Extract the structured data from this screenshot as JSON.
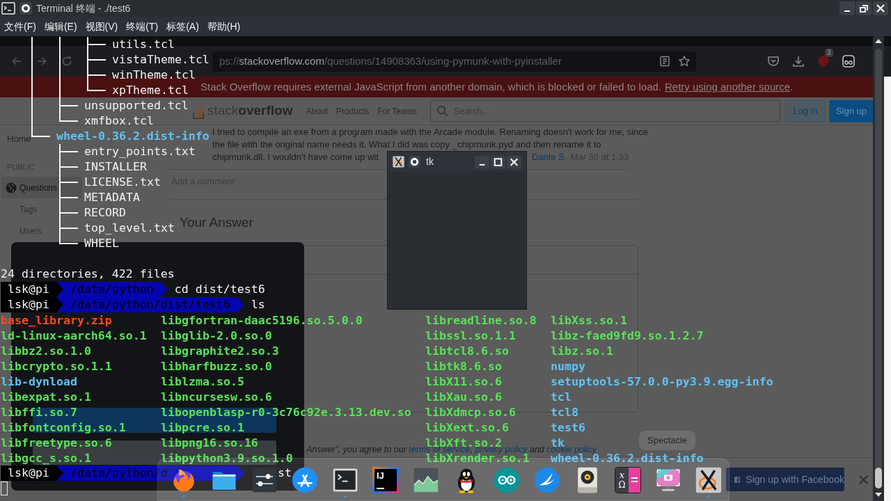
{
  "window": {
    "title": "Terminal 终端 - ./test6"
  },
  "menu": [
    "文件(F)",
    "编辑(E)",
    "视图(V)",
    "终端(T)",
    "标签(A)",
    "帮助(H)"
  ],
  "terminal": {
    "tree": [
      {
        "children": [
          {
            "children": [
              {
                "children": [
                  {
                    "name": "utils.tcl",
                    "kind": "file"
                  },
                  {
                    "name": "vistaTheme.tcl",
                    "kind": "file"
                  },
                  {
                    "name": "winTheme.tcl",
                    "kind": "file"
                  },
                  {
                    "name": "xpTheme.tcl",
                    "kind": "file"
                  }
                ]
              },
              {
                "name": "unsupported.tcl",
                "kind": "file"
              },
              {
                "name": "xmfbox.tcl",
                "kind": "file"
              }
            ]
          },
          {
            "name": "wheel-0.36.2.dist-info",
            "kind": "dir",
            "children": [
              {
                "name": "entry_points.txt",
                "kind": "file"
              },
              {
                "name": "INSTALLER",
                "kind": "file"
              },
              {
                "name": "LICENSE.txt",
                "kind": "file"
              },
              {
                "name": "METADATA",
                "kind": "file"
              },
              {
                "name": "RECORD",
                "kind": "file"
              },
              {
                "name": "top_level.txt",
                "kind": "file"
              },
              {
                "name": "WHEEL",
                "kind": "file"
              }
            ]
          }
        ]
      }
    ],
    "summary": "24 directories, 422 files",
    "prompts": [
      {
        "user": "lsk@pi",
        "path": "/data/python",
        "command": "cd dist/test6"
      },
      {
        "user": "lsk@pi",
        "path": "/data/python/dist/test6",
        "command": "ls"
      }
    ],
    "listing": [
      [
        {
          "name": "base_library.zip",
          "kind": "archive"
        },
        {
          "name": "ld-linux-aarch64.so.1",
          "kind": "exec"
        },
        {
          "name": "libbz2.so.1.0",
          "kind": "exec"
        },
        {
          "name": "libcrypto.so.1.1",
          "kind": "exec"
        },
        {
          "name": "lib-dynload",
          "kind": "dir"
        },
        {
          "name": "libexpat.so.1",
          "kind": "exec"
        },
        {
          "name": "libffi.so.7",
          "kind": "exec"
        },
        {
          "name": "libfontconfig.so.1",
          "kind": "exec"
        },
        {
          "name": "libfreetype.so.6",
          "kind": "exec"
        },
        {
          "name": "libgcc_s.so.1",
          "kind": "exec"
        }
      ],
      [
        {
          "name": "libgfortran-daac5196.so.5.0.0",
          "kind": "exec"
        },
        {
          "name": "libglib-2.0.so.0",
          "kind": "exec"
        },
        {
          "name": "libgraphite2.so.3",
          "kind": "exec"
        },
        {
          "name": "libharfbuzz.so.0",
          "kind": "exec"
        },
        {
          "name": "liblzma.so.5",
          "kind": "exec"
        },
        {
          "name": "libncursesw.so.6",
          "kind": "exec"
        },
        {
          "name": "libopenblasp-r0-3c76c92e.3.13.dev.so",
          "kind": "exec"
        },
        {
          "name": "libpcre.so.1",
          "kind": "exec"
        },
        {
          "name": "libpng16.so.16",
          "kind": "exec"
        },
        {
          "name": "libpython3.9.so.1.0",
          "kind": "exec"
        }
      ],
      [
        {
          "name": "libreadline.so.8",
          "kind": "exec"
        },
        {
          "name": "libssl.so.1.1",
          "kind": "exec"
        },
        {
          "name": "libtcl8.6.so",
          "kind": "exec"
        },
        {
          "name": "libtk8.6.so",
          "kind": "exec"
        },
        {
          "name": "libX11.so.6",
          "kind": "exec"
        },
        {
          "name": "libXau.so.6",
          "kind": "exec"
        },
        {
          "name": "libXdmcp.so.6",
          "kind": "exec"
        },
        {
          "name": "libXext.so.6",
          "kind": "exec"
        },
        {
          "name": "libXft.so.2",
          "kind": "exec"
        },
        {
          "name": "libXrender.so.1",
          "kind": "exec"
        }
      ],
      [
        {
          "name": "libXss.so.1",
          "kind": "exec"
        },
        {
          "name": "libz-faed9fd9.so.1.2.7",
          "kind": "exec"
        },
        {
          "name": "libz.so.1",
          "kind": "exec"
        },
        {
          "name": "numpy",
          "kind": "dir"
        },
        {
          "name": "setuptools-57.0.0-py3.9.egg-info",
          "kind": "dir"
        },
        {
          "name": "tcl",
          "kind": "dir"
        },
        {
          "name": "tcl8",
          "kind": "dir"
        },
        {
          "name": "test6",
          "kind": "dir"
        },
        {
          "name": "tk",
          "kind": "dir"
        },
        {
          "name": "wheel-0.36.2.dist-info",
          "kind": "dir"
        }
      ]
    ],
    "last_prompt": {
      "user": "lsk@pi",
      "path": "/data/python/d",
      "command": "st"
    }
  },
  "tk_window": {
    "title": "tk"
  },
  "browser": {
    "url": {
      "scheme": "ps://",
      "host": "stackoverflow.com",
      "path": "/questions/14908363/using-pymunk-with-pyinstaller"
    },
    "badge": "3",
    "banner": {
      "text": "Stack Overflow requires external JavaScript from another domain, which is blocked or failed to load.",
      "link": "Retry using another source",
      "tail": "."
    },
    "site": {
      "logo": "stack**overflow**",
      "nav": [
        "About",
        "Products",
        "For Teams"
      ],
      "search": {
        "placeholder": "Search…"
      },
      "buttons": [
        {
          "label": "Log in",
          "kind": "outline"
        },
        {
          "label": "Sign up",
          "kind": "primary"
        }
      ]
    },
    "sidebar": {
      "home": {
        "label": "Home",
        "selected": false
      },
      "section": "PUBLIC",
      "items": [
        {
          "label": "Questions",
          "selected": true
        },
        {
          "label": "Tags",
          "selected": false
        },
        {
          "label": "Users",
          "selected": false
        }
      ]
    },
    "comment": {
      "lines": [
        "I tried to compile an exe from a program made with the Arcade module. Renaming doesn't work for me, since",
        "the file with the original name needs it. What I did was copy _chipmunk.pyd and then rename it to",
        "chipmunk.dll. I wouldn't have come up wit"
      ],
      "author": "Dante S.",
      "date": "Mar 30 at 1:33"
    },
    "add_comment": "Add a comment",
    "answer_heading": "Your Answer",
    "terms": [
      {
        "text": "Answer”, you agree to our ",
        "kind": "text"
      },
      {
        "text": "terms of service",
        "kind": "link"
      },
      {
        "text": ", ",
        "kind": "text"
      },
      {
        "text": "privacy policy",
        "kind": "link"
      },
      {
        "text": " and ",
        "kind": "text"
      },
      {
        "text": "cookie policy",
        "kind": "link"
      }
    ],
    "cookie_dialog": {
      "buttons": [
        {
          "kind": "primary"
        },
        {
          "kind": "secondary"
        }
      ]
    },
    "signup_banner": {
      "button": "Sign up with Facebook"
    }
  },
  "dock": {
    "tooltip": "Spectacle",
    "items": [
      {
        "kind": "browser",
        "running": true
      },
      {
        "kind": "files",
        "running": false
      },
      {
        "kind": "settings",
        "running": false
      },
      {
        "kind": "store",
        "running": false
      },
      {
        "kind": "terminal",
        "running": true
      },
      {
        "kind": "ide",
        "glyph": "IJ",
        "running": false
      },
      {
        "kind": "monitor",
        "running": false
      },
      {
        "kind": "chat",
        "running": false
      },
      {
        "kind": "arduino",
        "running": false
      },
      {
        "kind": "bird",
        "running": false
      },
      {
        "kind": "audio",
        "running": false
      },
      {
        "kind": "math",
        "glyphs": [
          "x",
          "Ω",
          "="
        ],
        "running": false
      },
      {
        "kind": "screenshot",
        "running": false
      },
      {
        "kind": "xserver",
        "running": true
      }
    ]
  }
}
